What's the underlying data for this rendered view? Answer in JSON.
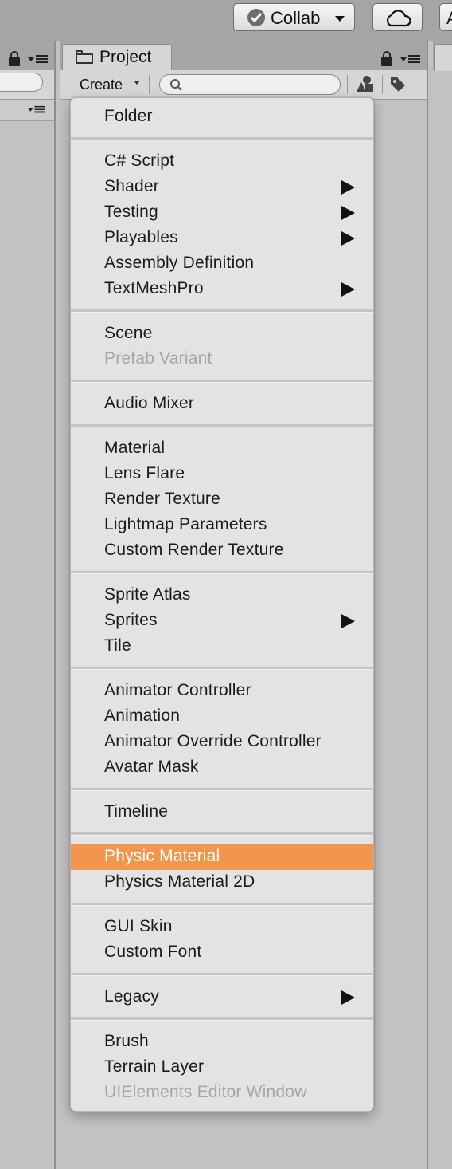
{
  "toolbar": {
    "collab_label": "Collab",
    "account_label_partial": "A"
  },
  "project_panel": {
    "tab_label": "Project",
    "create_label": "Create",
    "search_value": ""
  },
  "colors": {
    "highlight": "#f2964d",
    "menu_background": "#e3e3e3",
    "disabled_text": "#a6a6a6"
  },
  "menu": {
    "items": [
      {
        "label": "Folder",
        "submenu": false,
        "disabled": false,
        "highlighted": false
      },
      {
        "label": "C# Script",
        "submenu": false,
        "disabled": false,
        "highlighted": false
      },
      {
        "label": "Shader",
        "submenu": true,
        "disabled": false,
        "highlighted": false
      },
      {
        "label": "Testing",
        "submenu": true,
        "disabled": false,
        "highlighted": false
      },
      {
        "label": "Playables",
        "submenu": true,
        "disabled": false,
        "highlighted": false
      },
      {
        "label": "Assembly Definition",
        "submenu": false,
        "disabled": false,
        "highlighted": false
      },
      {
        "label": "TextMeshPro",
        "submenu": true,
        "disabled": false,
        "highlighted": false
      },
      {
        "label": "Scene",
        "submenu": false,
        "disabled": false,
        "highlighted": false
      },
      {
        "label": "Prefab Variant",
        "submenu": false,
        "disabled": true,
        "highlighted": false
      },
      {
        "label": "Audio Mixer",
        "submenu": false,
        "disabled": false,
        "highlighted": false
      },
      {
        "label": "Material",
        "submenu": false,
        "disabled": false,
        "highlighted": false
      },
      {
        "label": "Lens Flare",
        "submenu": false,
        "disabled": false,
        "highlighted": false
      },
      {
        "label": "Render Texture",
        "submenu": false,
        "disabled": false,
        "highlighted": false
      },
      {
        "label": "Lightmap Parameters",
        "submenu": false,
        "disabled": false,
        "highlighted": false
      },
      {
        "label": "Custom Render Texture",
        "submenu": false,
        "disabled": false,
        "highlighted": false
      },
      {
        "label": "Sprite Atlas",
        "submenu": false,
        "disabled": false,
        "highlighted": false
      },
      {
        "label": "Sprites",
        "submenu": true,
        "disabled": false,
        "highlighted": false
      },
      {
        "label": "Tile",
        "submenu": false,
        "disabled": false,
        "highlighted": false
      },
      {
        "label": "Animator Controller",
        "submenu": false,
        "disabled": false,
        "highlighted": false
      },
      {
        "label": "Animation",
        "submenu": false,
        "disabled": false,
        "highlighted": false
      },
      {
        "label": "Animator Override Controller",
        "submenu": false,
        "disabled": false,
        "highlighted": false
      },
      {
        "label": "Avatar Mask",
        "submenu": false,
        "disabled": false,
        "highlighted": false
      },
      {
        "label": "Timeline",
        "submenu": false,
        "disabled": false,
        "highlighted": false
      },
      {
        "label": "Physic Material",
        "submenu": false,
        "disabled": false,
        "highlighted": true
      },
      {
        "label": "Physics Material 2D",
        "submenu": false,
        "disabled": false,
        "highlighted": false
      },
      {
        "label": "GUI Skin",
        "submenu": false,
        "disabled": false,
        "highlighted": false
      },
      {
        "label": "Custom Font",
        "submenu": false,
        "disabled": false,
        "highlighted": false
      },
      {
        "label": "Legacy",
        "submenu": true,
        "disabled": false,
        "highlighted": false
      },
      {
        "label": "Brush",
        "submenu": false,
        "disabled": false,
        "highlighted": false
      },
      {
        "label": "Terrain Layer",
        "submenu": false,
        "disabled": false,
        "highlighted": false
      },
      {
        "label": "UIElements Editor Window",
        "submenu": false,
        "disabled": true,
        "highlighted": false
      }
    ]
  }
}
